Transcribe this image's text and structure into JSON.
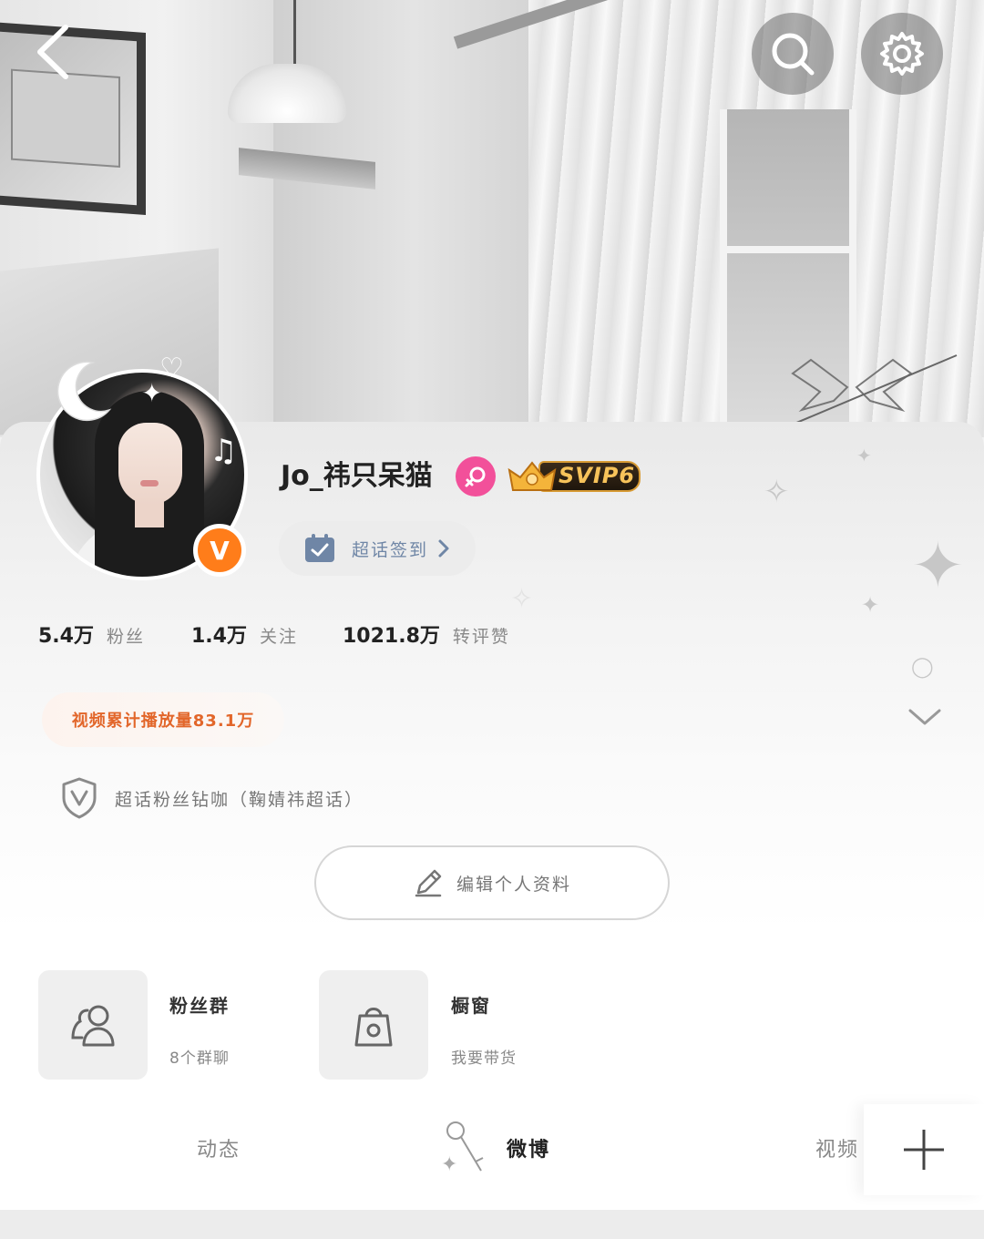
{
  "header": {
    "back_icon": "chevron-left-icon",
    "search_icon": "search-icon",
    "settings_icon": "gear-icon"
  },
  "profile": {
    "username": "Jo_祎只呆猫",
    "gender_icon": "female-icon",
    "verified_badge": "V",
    "membership_badge": "SVIP6",
    "checkin_label": "超话签到"
  },
  "stats": [
    {
      "value": "5.4万",
      "label": "粉丝"
    },
    {
      "value": "1.4万",
      "label": "关注"
    },
    {
      "value": "1021.8万",
      "label": "转评赞"
    }
  ],
  "video_views": "视频累计播放量83.1万",
  "superfan_title": "超话粉丝钻咖（鞠婧祎超话）",
  "edit_profile_label": "编辑个人资料",
  "features": [
    {
      "title": "粉丝群",
      "subtitle": "8个群聊",
      "icon": "users-icon"
    },
    {
      "title": "橱窗",
      "subtitle": "我要带货",
      "icon": "shopping-bag-icon"
    }
  ],
  "tabs": [
    {
      "label": "动态",
      "active": false
    },
    {
      "label": "微博",
      "active": true
    },
    {
      "label": "视频",
      "active": false
    }
  ],
  "colors": {
    "accent_orange": "#ff7d1a",
    "video_text": "#e2662a",
    "gender_pink": "#f2509a",
    "checkin_text": "#6f86a6"
  }
}
